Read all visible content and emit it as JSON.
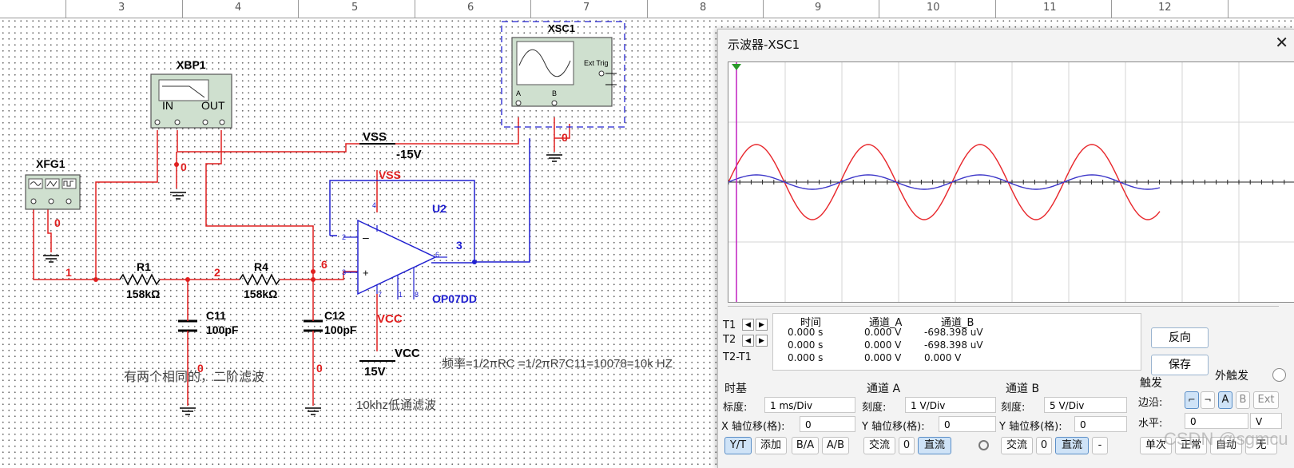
{
  "ruler": {
    "ticks": [
      "3",
      "4",
      "5",
      "6",
      "7",
      "8",
      "9",
      "10",
      "11",
      "12"
    ]
  },
  "schematic": {
    "xbp1": {
      "name": "XBP1",
      "in": "IN",
      "out": "OUT"
    },
    "xfg1": {
      "name": "XFG1"
    },
    "xsc1": {
      "name": "XSC1",
      "ch_a": "A",
      "ch_b": "B",
      "ext_trig": "Ext Trig"
    },
    "vss_label": "VSS",
    "vss_value": "-15V",
    "vss_pin": "VSS",
    "vcc_pin": "VCC",
    "vcc_label": "VCC",
    "vcc_value": "15V",
    "u2": "U2",
    "opamp_model": "OP07DD",
    "r1": {
      "name": "R1",
      "value": "158kΩ"
    },
    "r4": {
      "name": "R4",
      "value": "158kΩ"
    },
    "c11": {
      "name": "C11",
      "value": "100pF"
    },
    "c12": {
      "name": "C12",
      "value": "100pF"
    },
    "nets": {
      "n1": "1",
      "n2": "2",
      "n3": "3",
      "n6": "6",
      "n0a": "0",
      "n0b": "0",
      "n0c": "0",
      "n0d": "0",
      "n0e": "0"
    },
    "pins": {
      "p4": "4",
      "p2": "2",
      "p3": "3",
      "p6": "6",
      "p7": "7",
      "p1": "1",
      "p8": "8"
    },
    "notes": {
      "note1": "有两个相同的，二阶滤波",
      "note2": "频率=1/2πRC =1/2πR7C11=10078=10k HZ",
      "note3": "10khz低通滤波"
    }
  },
  "oscilloscope": {
    "title": "示波器-XSC1",
    "readout": {
      "headers": [
        "时间",
        "通道_A",
        "通道_B"
      ],
      "rows": [
        {
          "label": "T1",
          "time": "0.000 s",
          "a": "0.000 V",
          "b": "-698.398 uV"
        },
        {
          "label": "T2",
          "time": "0.000 s",
          "a": "0.000 V",
          "b": "-698.398 uV"
        },
        {
          "label": "T2-T1",
          "time": "0.000 s",
          "a": "0.000 V",
          "b": "0.000 V"
        }
      ]
    },
    "buttons": {
      "reverse": "反向",
      "save": "保存",
      "ext_trigger": "外触发"
    },
    "timebase": {
      "title": "时基",
      "scale_label": "标度:",
      "scale": "1 ms/Div",
      "xpos_label": "X 轴位移(格):",
      "xpos": "0",
      "modes": [
        "Y/T",
        "添加",
        "B/A",
        "A/B"
      ]
    },
    "channel_a": {
      "title": "通道 A",
      "scale_label": "刻度:",
      "scale": "1  V/Div",
      "ypos_label": "Y 轴位移(格):",
      "ypos": "0",
      "coupling": [
        "交流",
        "0",
        "直流"
      ]
    },
    "channel_b": {
      "title": "通道 B",
      "scale_label": "刻度:",
      "scale": "5  V/Div",
      "ypos_label": "Y 轴位移(格):",
      "ypos": "0",
      "coupling": [
        "交流",
        "0",
        "直流",
        "-"
      ]
    },
    "trigger": {
      "title": "触发",
      "edge_label": "边沿:",
      "edge_buttons": [
        "A",
        "B",
        "Ext"
      ],
      "level_label": "水平:",
      "level": "0",
      "level_unit": "V",
      "modes": [
        "单次",
        "正常",
        "自动",
        "无"
      ]
    },
    "colors": {
      "channel_a": "#e8262b",
      "channel_b": "#3b35c8",
      "wire": "#e02020",
      "wire_blue": "#2020d0",
      "net_label": "#e02020"
    },
    "watermark": "CSDN @sgmcu"
  }
}
